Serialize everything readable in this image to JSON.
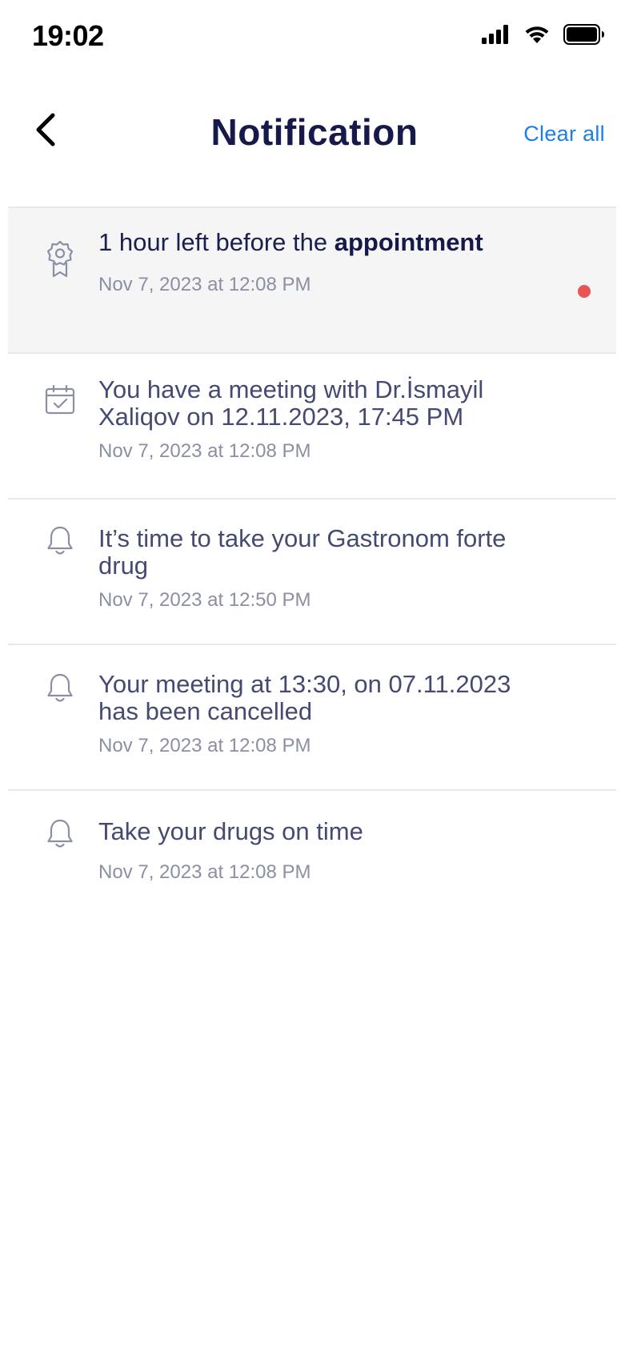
{
  "status_bar": {
    "time": "19:02",
    "icons": [
      "signal-icon",
      "wifi-icon",
      "battery-icon"
    ]
  },
  "header": {
    "title": "Notification",
    "clear_all_label": "Clear all",
    "back_icon": "chevron-left-icon"
  },
  "notifications": [
    {
      "icon": "badge-icon",
      "title_prefix": "1 hour left before the ",
      "title_bold": "appointment",
      "date": "Nov 7, 2023 at 12:08 PM",
      "unread": true
    },
    {
      "icon": "calendar-check-icon",
      "title": "You have a meeting with Dr.İsmayil Xaliqov on 12.11.2023, 17:45 PM",
      "date": "Nov 7, 2023 at 12:08 PM",
      "unread": false
    },
    {
      "icon": "bell-icon",
      "title": "It’s time to take your Gastronom forte drug",
      "date": "Nov 7, 2023 at 12:50 PM",
      "unread": false
    },
    {
      "icon": "bell-icon",
      "title": "Your meeting at 13:30, on 07.11.2023 has been cancelled",
      "date": "Nov 7, 2023 at 12:08 PM",
      "unread": false
    },
    {
      "icon": "bell-icon",
      "title": "Take your drugs on time",
      "date": "Nov 7, 2023 at 12:08 PM",
      "unread": false
    }
  ],
  "colors": {
    "accent": "#1a7fe6",
    "title": "#161a4a",
    "unread_dot": "#e85452",
    "unread_background": "#f5f5f6"
  }
}
